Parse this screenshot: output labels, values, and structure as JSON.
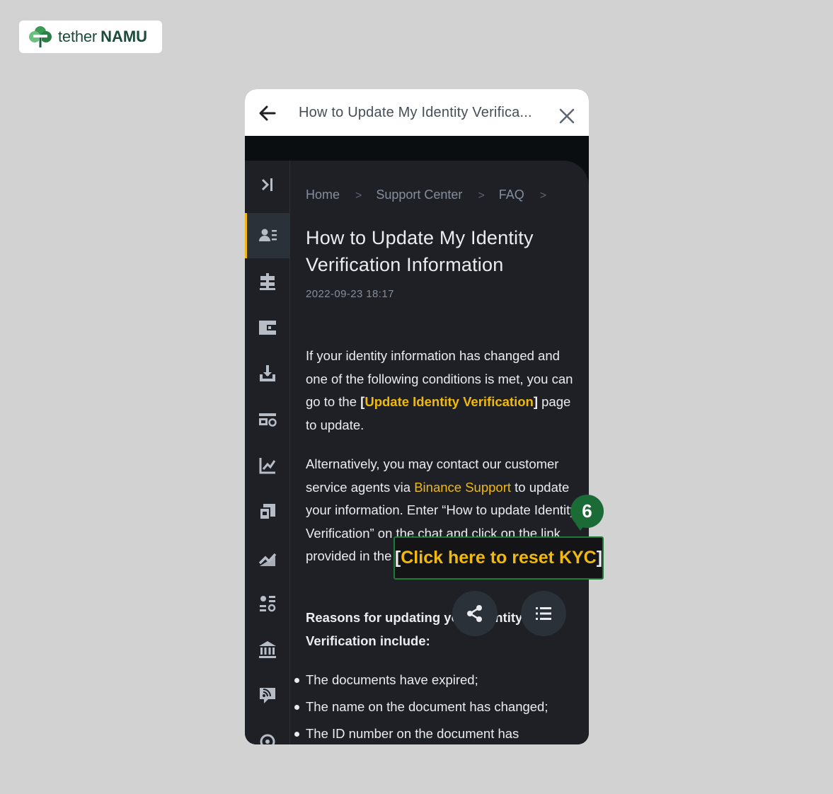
{
  "logo": {
    "word1": "tether",
    "word2": "NAMU"
  },
  "topbar": {
    "title": "How to Update My Identity Verifica...",
    "back_icon": "arrow-left-icon",
    "close_icon": "close-icon"
  },
  "sidebar": {
    "items": [
      {
        "icon": "collapse-sidebar-icon"
      },
      {
        "icon": "account-icon",
        "active": true
      },
      {
        "icon": "signpost-icon"
      },
      {
        "icon": "wallet-icon"
      },
      {
        "icon": "deposit-icon"
      },
      {
        "icon": "card-settings-icon"
      },
      {
        "icon": "chart-icon"
      },
      {
        "icon": "p2p-icon"
      },
      {
        "icon": "trend-icon"
      },
      {
        "icon": "apps-icon"
      },
      {
        "icon": "bank-icon"
      },
      {
        "icon": "feed-icon"
      },
      {
        "icon": "more-icon"
      }
    ]
  },
  "breadcrumb": {
    "items": [
      "Home",
      "Support Center",
      "FAQ"
    ],
    "separator": ">"
  },
  "article": {
    "title": "How to Update My Identity Verification Information",
    "date": "2022-09-23 18:17",
    "p1_a": "If your identity information has changed and one of the following conditions is met, you can go to the ",
    "p1_open": "[",
    "p1_link": "Update Identity Verification",
    "p1_close": "]",
    "p1_b": " page to update.",
    "p2_a": "Alternatively, you may contact our customer service agents via ",
    "p2_link": "Binance Support",
    "p2_b": " to update your information. Enter “How to update Identity Verification” on the chat and click on the link ",
    "p2_c": " provided in the Customer Service response.",
    "p3_bold": "Reasons for updating your Identity Verification include:",
    "bullets": [
      "The documents have expired;",
      "The name on the document has changed;",
      "The ID number on the document has"
    ]
  },
  "fab": {
    "share_icon": "share-icon",
    "toc_icon": "list-icon"
  },
  "annotation": {
    "step": "6",
    "open": "[",
    "text": "Click here to reset KYC",
    "close": "]",
    "color": "#f0b90b"
  }
}
